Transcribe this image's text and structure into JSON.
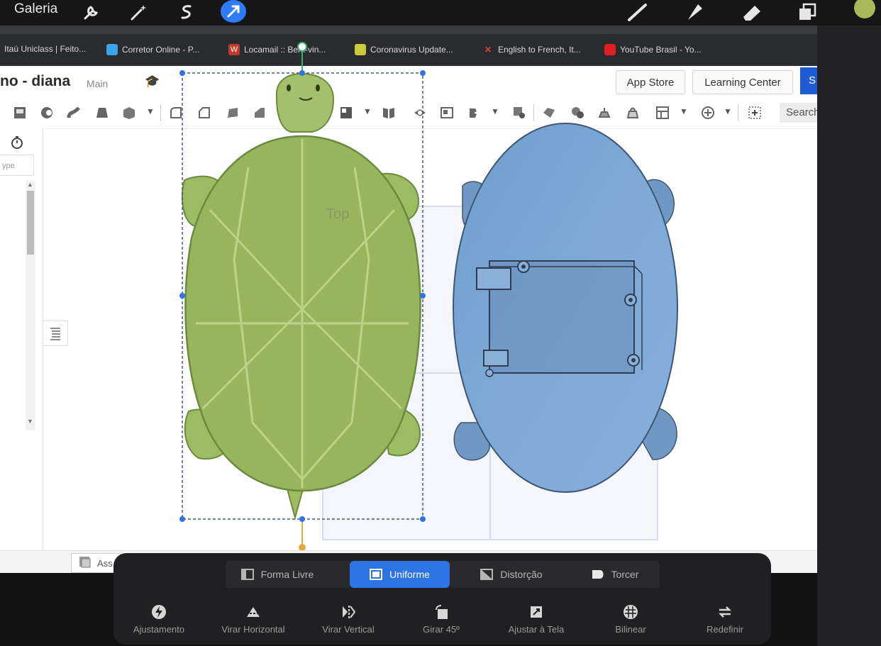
{
  "procreate": {
    "gallery_label": "Galeria",
    "tools": [
      "wrench-icon",
      "magic-wand-icon",
      "selection-icon",
      "transform-arrow-icon",
      "brush-icon",
      "smudge-icon",
      "eraser-icon",
      "layers-icon"
    ],
    "color": "#a8b85a",
    "transform_modes": [
      {
        "label": "Forma Livre",
        "icon": "freeform-icon",
        "active": false
      },
      {
        "label": "Uniforme",
        "icon": "uniform-icon",
        "active": true
      },
      {
        "label": "Distorção",
        "icon": "distort-icon",
        "active": false
      },
      {
        "label": "Torcer",
        "icon": "warp-icon",
        "active": false
      }
    ],
    "actions": [
      {
        "label": "Ajustamento",
        "icon": "snapping-icon"
      },
      {
        "label": "Virar Horizontal",
        "icon": "flip-horizontal-icon"
      },
      {
        "label": "Virar Vertical",
        "icon": "flip-vertical-icon"
      },
      {
        "label": "Girar 45º",
        "icon": "rotate-icon"
      },
      {
        "label": "Ajustar à Tela",
        "icon": "fit-to-screen-icon"
      },
      {
        "label": "Bilinear",
        "icon": "bilinear-icon"
      },
      {
        "label": "Redefinir",
        "icon": "reset-icon"
      }
    ]
  },
  "browser": {
    "bookmarks": [
      {
        "label": "Itaú Uniclass | Feito...",
        "color": "#e0822a"
      },
      {
        "label": "Corretor Online - P...",
        "color": "#3ba4e8"
      },
      {
        "label": "Locamail :: Bem-vin...",
        "color": "#c0392b"
      },
      {
        "label": "Coronavirus Update...",
        "color": "#c9cc3a"
      },
      {
        "label": "English to French, It...",
        "color": "#d04a35"
      },
      {
        "label": "YouTube Brasil - Yo...",
        "color": "#e02020"
      }
    ]
  },
  "onshape": {
    "doc_title": "no - diana",
    "workspace": "Main",
    "app_store": "App Store",
    "learning_center": "Learning Center",
    "blue_btn": "S",
    "search": "Search",
    "filter_placeholder": "ype",
    "view_label": "Top",
    "bottom_tab": "Ass"
  }
}
